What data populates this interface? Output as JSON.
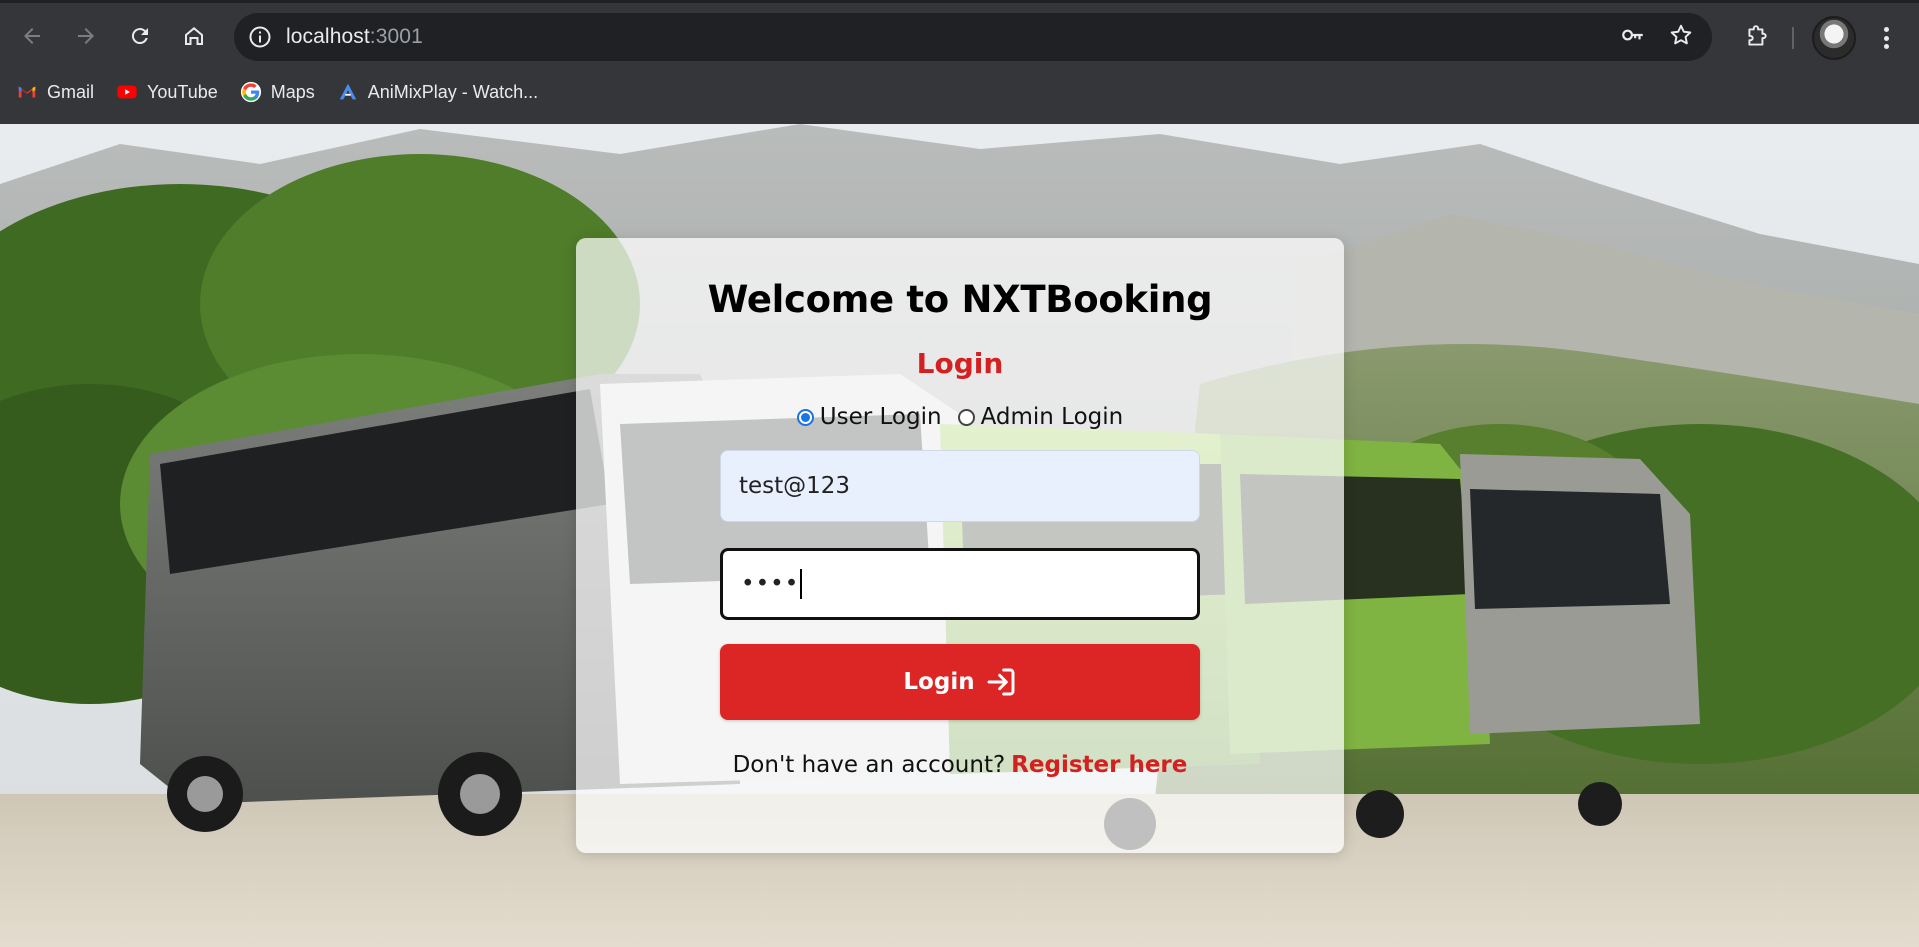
{
  "browser": {
    "url_host": "localhost",
    "url_port": ":3001",
    "bookmarks": [
      {
        "label": "Gmail",
        "icon": "gmail-icon"
      },
      {
        "label": "YouTube",
        "icon": "youtube-icon"
      },
      {
        "label": "Maps",
        "icon": "google-icon"
      },
      {
        "label": "AniMixPlay - Watch...",
        "icon": "animixplay-icon"
      }
    ]
  },
  "login": {
    "title": "Welcome to NXTBooking",
    "subtitle": "Login",
    "user_option": "User Login",
    "admin_option": "Admin Login",
    "selected_option": "User Login",
    "email_value": "test@123",
    "password_mask": "••••",
    "submit_label": "Login",
    "register_prompt": "Don't have an account?",
    "register_link": "Register here"
  },
  "colors": {
    "accent_red": "#dc2626",
    "autofill_blue": "#e8f0fe",
    "radio_blue": "#1a73e8"
  }
}
